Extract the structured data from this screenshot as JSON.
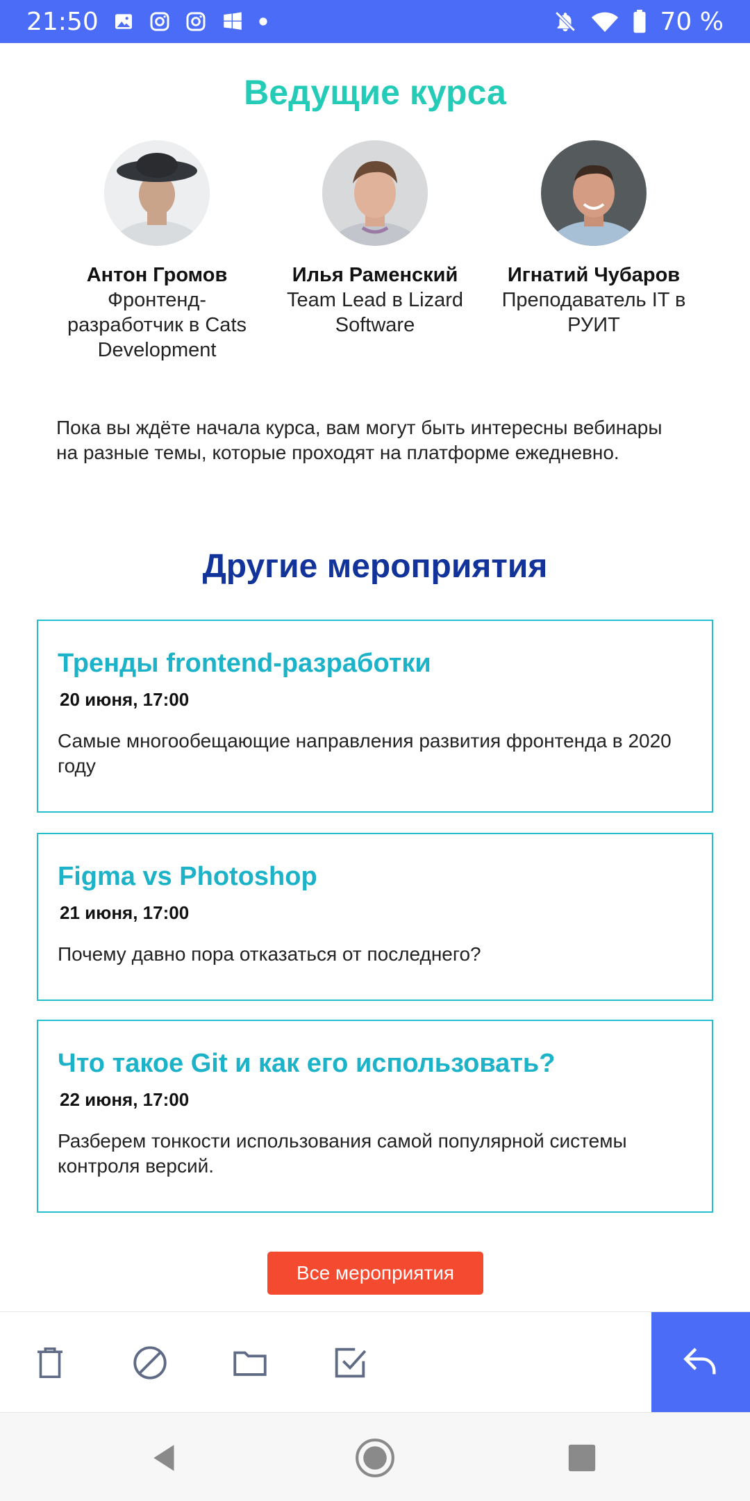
{
  "status_bar": {
    "time": "21:50",
    "left_icons": [
      "image-icon",
      "instagram-icon",
      "instagram-icon",
      "windows-icon",
      "dot-icon"
    ],
    "right_icons": [
      "notifications-off-icon",
      "wifi-icon",
      "battery-icon"
    ],
    "battery": "70 %"
  },
  "instructors": {
    "title": "Ведущие курса",
    "items": [
      {
        "name": "Антон Громов",
        "role": "Фронтенд-разработчик в Cats Development"
      },
      {
        "name": "Илья Раменский",
        "role": "Team Lead в Lizard Software"
      },
      {
        "name": "Игнатий Чубаров",
        "role": "Преподаватель IT в РУИТ"
      }
    ]
  },
  "intro_text": "Пока вы ждёте начала курса, вам могут быть интересны вебинары на разные темы, которые проходят на платформе ежедневно.",
  "events": {
    "title": "Другие мероприятия",
    "items": [
      {
        "title": "Тренды frontend-разработки",
        "date": "20 июня, 17:00",
        "description": "Самые многообещающие направления развития фронтенда в 2020 году"
      },
      {
        "title": "Figma vs Photoshop",
        "date": "21 июня, 17:00",
        "description": "Почему давно пора отказаться от последнего?"
      },
      {
        "title": "Что такое Git и как его использовать?",
        "date": "22 июня, 17:00",
        "description": "Разберем тонкости использования самой популярной системы контроля версий."
      }
    ],
    "all_button": "Все мероприятия"
  },
  "toolbar": {
    "icons": [
      "trash-icon",
      "block-icon",
      "folder-icon",
      "mark-done-icon",
      "reply-icon"
    ]
  },
  "nav_bar": {
    "icons": [
      "back-icon",
      "home-icon",
      "recents-icon"
    ]
  },
  "colors": {
    "status_bar": "#4a6cf7",
    "instructors_title": "#24ccb8",
    "events_title": "#12349a",
    "event_title": "#1cb3c9",
    "event_border": "#24c0d0",
    "button": "#f44a30",
    "toolbar_icon": "#5f6b84"
  }
}
